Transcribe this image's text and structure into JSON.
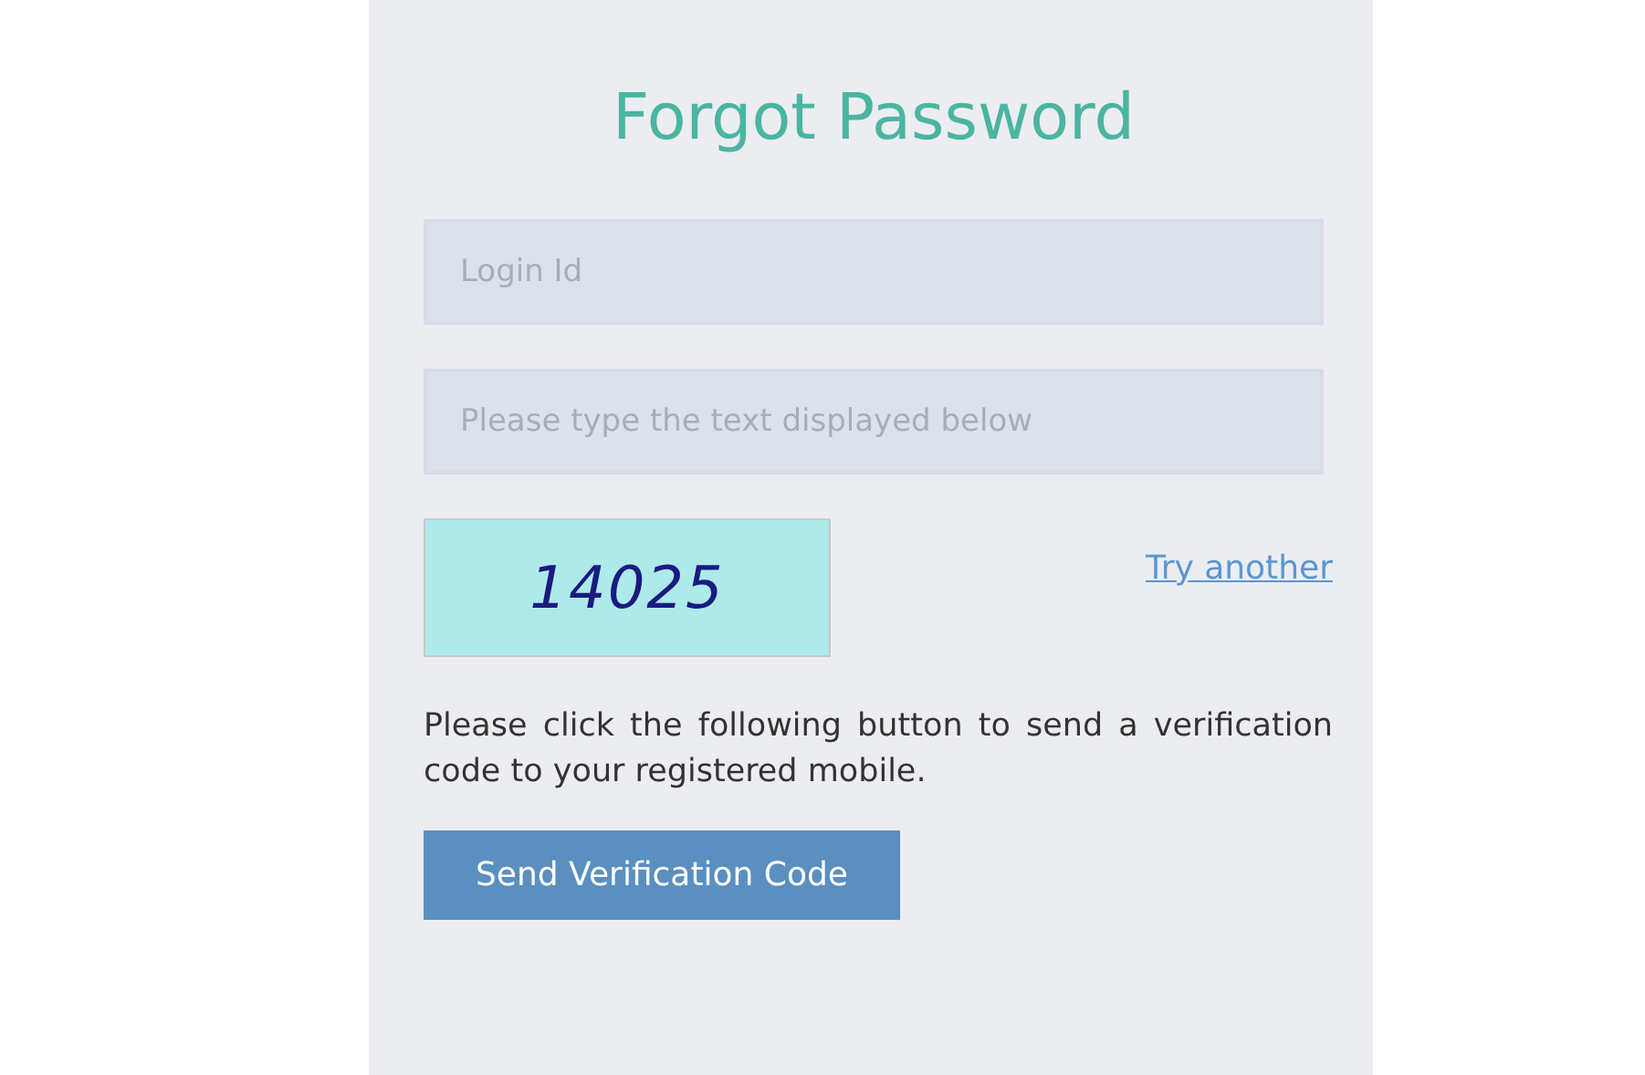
{
  "title": "Forgot Password",
  "fields": [
    {
      "placeholder": "Login Id"
    },
    {
      "placeholder": "Please type the text displayed below"
    }
  ],
  "captcha": {
    "text": "14025",
    "link": "Try another"
  },
  "instructions": "Please click the following button to send a verification code to your registered mobile.",
  "button": "Send Verification Code"
}
